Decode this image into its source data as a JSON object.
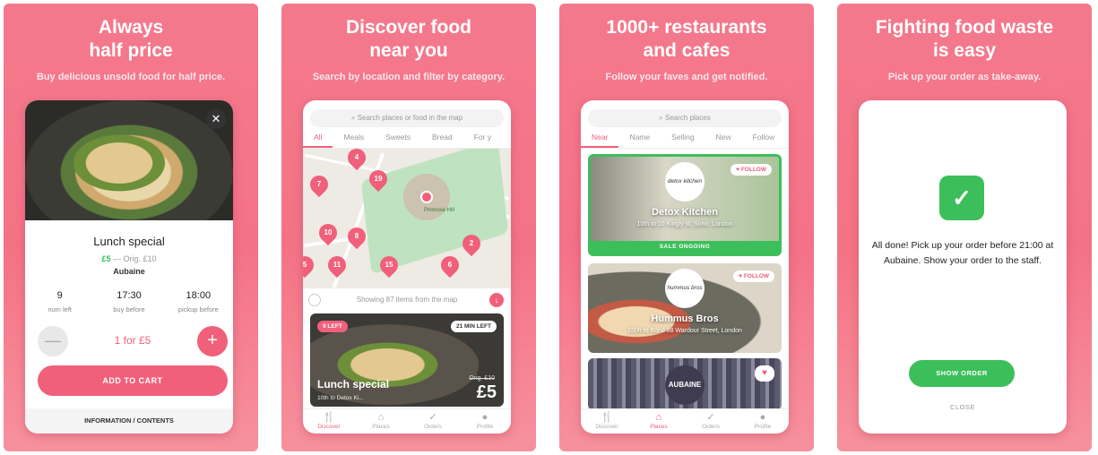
{
  "panel1": {
    "title": "Always\nhalf price",
    "subtitle": "Buy delicious unsold food for half price.",
    "close": "✕",
    "item_name": "Lunch special",
    "price_new": "£5",
    "price_orig": "— Orig. £10",
    "restaurant": "Aubaine",
    "stats": [
      {
        "value": "9",
        "label": "num left"
      },
      {
        "value": "17:30",
        "label": "buy before"
      },
      {
        "value": "18:00",
        "label": "pickup before"
      }
    ],
    "minus": "—",
    "plus": "+",
    "qty_text": "1 for £5",
    "add_to_cart": "ADD TO CART",
    "info": "INFORMATION / CONTENTS"
  },
  "panel2": {
    "title": "Discover food\nnear you",
    "subtitle": "Search by location and filter by category.",
    "search_placeholder": "Search places or food in the map",
    "tabs": [
      "All",
      "Meals",
      "Sweets",
      "Bread",
      "For y"
    ],
    "map_label": "Primrose Hill",
    "pins": [
      "4",
      "7",
      "19",
      "10",
      "8",
      "2",
      "11",
      "15",
      "6",
      "5"
    ],
    "showing": "Showing 87 items from the map",
    "card": {
      "left_badge": "9 LEFT",
      "right_badge": "21 MIN LEFT",
      "title": "Lunch special",
      "address": "10th to Detox Ki...",
      "orig": "Orig. £10",
      "price": "£5"
    },
    "nav": [
      {
        "icon": "fork-knife-icon",
        "glyph": "🍴",
        "label": "Discover"
      },
      {
        "icon": "home-icon",
        "glyph": "⌂",
        "label": "Places"
      },
      {
        "icon": "check-circle-icon",
        "glyph": "✓",
        "label": "Orders"
      },
      {
        "icon": "person-icon",
        "glyph": "●",
        "label": "Profile"
      }
    ]
  },
  "panel3": {
    "title": "1000+ restaurants\nand cafes",
    "subtitle": "Follow your faves and get notified.",
    "search_placeholder": "Search places",
    "tabs": [
      "Near",
      "Name",
      "Selling",
      "New",
      "Follow"
    ],
    "restaurants": [
      {
        "logo": "detox kitchen",
        "name": "Detox Kitchen",
        "address": "10th to 10 Kingly st, Soho, London",
        "follow": "♥ FOLLOW",
        "sale": "SALE ONGOING"
      },
      {
        "logo": "hummus bros",
        "name": "Hummus Bros",
        "address": "150ft to Bond 88 Wardour Street, London",
        "follow": "♥ FOLLOW"
      },
      {
        "logo": "AUBAINE",
        "heart": "♥"
      }
    ],
    "nav": [
      {
        "icon": "fork-knife-icon",
        "glyph": "🍴",
        "label": "Discover"
      },
      {
        "icon": "home-icon",
        "glyph": "⌂",
        "label": "Places"
      },
      {
        "icon": "check-circle-icon",
        "glyph": "✓",
        "label": "Orders"
      },
      {
        "icon": "person-icon",
        "glyph": "●",
        "label": "Profile"
      }
    ]
  },
  "panel4": {
    "title": "Fighting food waste\nis easy",
    "subtitle": "Pick up your order as take-away.",
    "check": "✓",
    "message": "All done! Pick up your order before 21:00 at Aubaine. Show your order to the staff.",
    "show_order": "SHOW ORDER",
    "close": "CLOSE"
  },
  "colors": {
    "accent": "#f0607a",
    "success": "#3cbf5a",
    "panel_bg": "#f4798c"
  }
}
